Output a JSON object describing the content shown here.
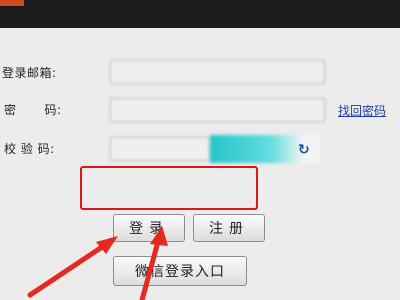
{
  "form": {
    "email_label": "登录邮箱:",
    "password_label_left": "密",
    "password_label_right": "码:",
    "captcha_label": "校 验 码:",
    "email_value": "",
    "password_value": "",
    "captcha_value": ""
  },
  "links": {
    "forgot_password": "找回密码"
  },
  "buttons": {
    "login": "登录",
    "register": "注册",
    "wechat_login": "微信登录入口"
  },
  "icons": {
    "captcha_refresh": "refresh-icon",
    "annotation_arrow": "red-arrow-icon"
  },
  "colors": {
    "highlight_box": "#e0151a",
    "arrow": "#e8271f",
    "link": "#1a3fb0",
    "captcha": "#25c4c9"
  }
}
